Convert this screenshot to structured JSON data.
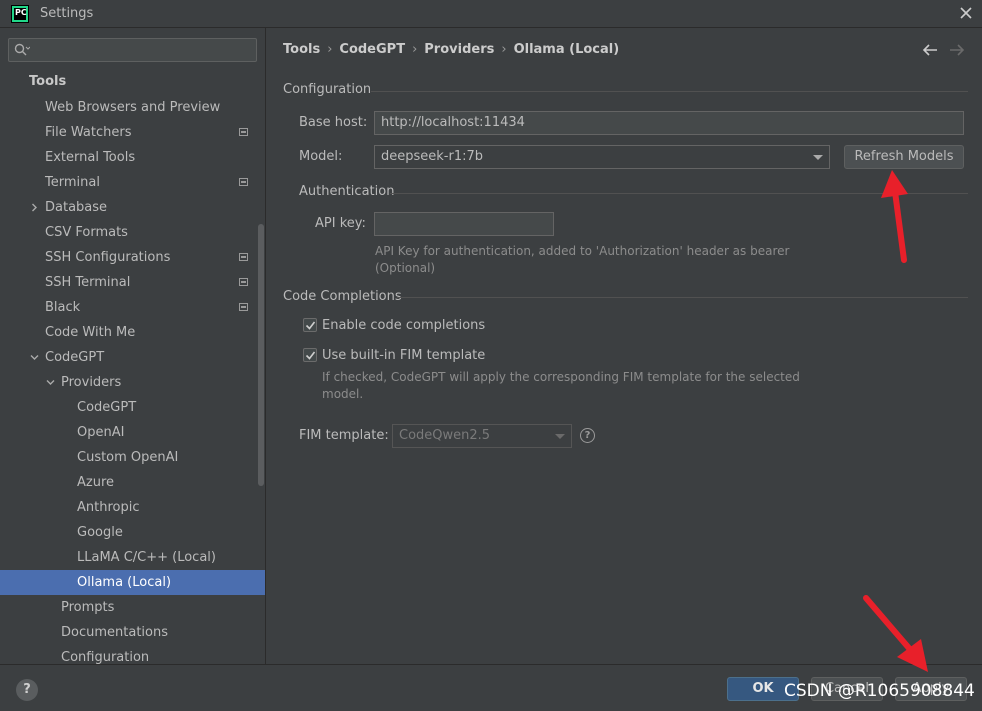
{
  "window": {
    "title": "Settings",
    "logo_text": "PC"
  },
  "sidebar": {
    "search": {
      "placeholder": "",
      "value": ""
    },
    "header": "Tools",
    "items": [
      {
        "label": "Web Browsers and Preview",
        "indent": 1,
        "has_settings_icon": false
      },
      {
        "label": "File Watchers",
        "indent": 1,
        "has_settings_icon": true
      },
      {
        "label": "External Tools",
        "indent": 1,
        "has_settings_icon": false
      },
      {
        "label": "Terminal",
        "indent": 1,
        "has_settings_icon": true
      },
      {
        "label": "Database",
        "indent": 1,
        "expandable": "collapsed"
      },
      {
        "label": "CSV Formats",
        "indent": 1
      },
      {
        "label": "SSH Configurations",
        "indent": 1,
        "has_settings_icon": true
      },
      {
        "label": "SSH Terminal",
        "indent": 1,
        "has_settings_icon": true
      },
      {
        "label": "Black",
        "indent": 1,
        "has_settings_icon": true
      },
      {
        "label": "Code With Me",
        "indent": 1
      },
      {
        "label": "CodeGPT",
        "indent": 1,
        "expandable": "expanded"
      },
      {
        "label": "Providers",
        "indent": 2,
        "expandable": "expanded"
      },
      {
        "label": "CodeGPT",
        "indent": 3
      },
      {
        "label": "OpenAI",
        "indent": 3
      },
      {
        "label": "Custom OpenAI",
        "indent": 3
      },
      {
        "label": "Azure",
        "indent": 3
      },
      {
        "label": "Anthropic",
        "indent": 3
      },
      {
        "label": "Google",
        "indent": 3
      },
      {
        "label": "LLaMA C/C++ (Local)",
        "indent": 3
      },
      {
        "label": "Ollama (Local)",
        "indent": 3,
        "selected": true
      },
      {
        "label": "Prompts",
        "indent": 2
      },
      {
        "label": "Documentations",
        "indent": 2
      },
      {
        "label": "Configuration",
        "indent": 2
      }
    ]
  },
  "breadcrumb": [
    "Tools",
    "CodeGPT",
    "Providers",
    "Ollama (Local)"
  ],
  "configuration": {
    "section_label": "Configuration",
    "base_host_label": "Base host:",
    "base_host_value": "http://localhost:11434",
    "model_label": "Model:",
    "model_value": "deepseek-r1:7b",
    "refresh_button": "Refresh Models"
  },
  "authentication": {
    "section_label": "Authentication",
    "api_key_label": "API key:",
    "api_key_value": "",
    "hint": "API Key for authentication, added to 'Authorization' header as bearer (Optional)"
  },
  "code_completions": {
    "section_label": "Code Completions",
    "enable_label": "Enable code completions",
    "enable_checked": true,
    "fim_builtin_label": "Use built-in FIM template",
    "fim_builtin_checked": true,
    "fim_hint": "If checked, CodeGPT will apply the corresponding FIM template for the selected model.",
    "fim_template_label": "FIM template:",
    "fim_template_value": "CodeQwen2.5",
    "help_glyph": "?"
  },
  "footer": {
    "help_glyph": "?",
    "ok": "OK",
    "cancel": "Cancel",
    "apply": "Apply"
  },
  "watermark": "CSDN @R1065908844",
  "colors": {
    "background": "#3c3f41",
    "selection": "#4b6eaf",
    "ok_button": "#365880",
    "annotation_arrow": "#e8202a"
  }
}
